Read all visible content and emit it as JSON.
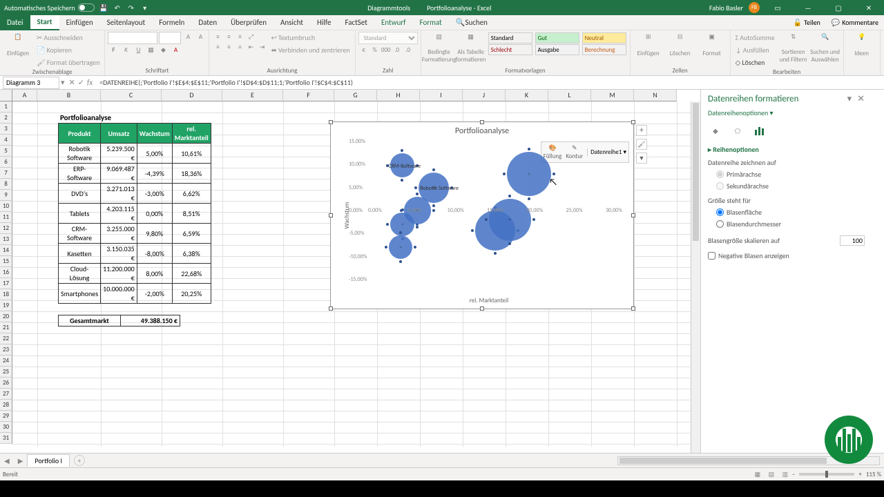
{
  "title_bar": {
    "autosave": "Automatisches Speichern",
    "tooltitle": "Diagrammtools",
    "filetitle": "Portfolioanalyse - Excel",
    "user": "Fabio Basler",
    "user_initials": "FB"
  },
  "ribbon_tabs": {
    "datei": "Datei",
    "start": "Start",
    "einf": "Einfügen",
    "seitenlayout": "Seitenlayout",
    "formeln": "Formeln",
    "daten": "Daten",
    "ueber": "Überprüfen",
    "ansicht": "Ansicht",
    "hilfe": "Hilfe",
    "factset": "FactSet",
    "entwurf": "Entwurf",
    "format": "Format",
    "search": "Suchen",
    "teilen": "Teilen",
    "kommentare": "Kommentare"
  },
  "ribbon_groups": {
    "g1": "Zwischenablage",
    "g2": "Schriftart",
    "g3": "Ausrichtung",
    "g4": "Zahl",
    "g5": "Formatvorlagen",
    "g6": "Zellen",
    "g7": "Bearbeiten",
    "einfuegen": "Einfügen",
    "ausschneiden": "Ausschneiden",
    "kopieren": "Kopieren",
    "formatueb": "Format übertragen",
    "textumbruch": "Textumbruch",
    "verbinden": "Verbinden und zentrieren",
    "bedingte": "Bedingte\nFormatierung",
    "alstabelle": "Als Tabelle\nformatieren",
    "standard": "Standard",
    "gut": "Gut",
    "neutral": "Neutral",
    "schlecht": "Schlecht",
    "ausgabe": "Ausgabe",
    "berechnung": "Berechnung",
    "cell_einf": "Einfügen",
    "cell_del": "Löschen",
    "cell_fmt": "Format",
    "autosumme": "AutoSumme",
    "ausfuellen": "Ausfüllen",
    "loeschen": "Löschen",
    "sortfilt": "Sortieren und\nFiltern",
    "suchausw": "Suchen und\nAuswählen",
    "ideen": "Ideen",
    "numfmt": "Standard"
  },
  "fx": {
    "namebox": "Diagramm 3",
    "formula": "=DATENREIHE(;'Portfolio I'!$E$4:$E$11;'Portfolio I'!$D$4:$D$11;1;'Portfolio I'!$C$4:$C$11)"
  },
  "columns": [
    "A",
    "B",
    "C",
    "D",
    "E",
    "F",
    "G",
    "H",
    "I",
    "J",
    "K",
    "L",
    "M",
    "N"
  ],
  "table": {
    "title": "Portfolioanalyse",
    "headers": [
      "Produkt",
      "Umsatz",
      "Wachstum",
      "rel. Marktanteil"
    ],
    "rows": [
      [
        "Robotik Software",
        "5.239.500 €",
        "5,00%",
        "10,61%"
      ],
      [
        "ERP-Software",
        "9.069.487 €",
        "-4,39%",
        "18,36%"
      ],
      [
        "DVD's",
        "3.271.013 €",
        "-3,00%",
        "6,62%"
      ],
      [
        "Tablets",
        "4.203.115 €",
        "0,00%",
        "8,51%"
      ],
      [
        "CRM-Software",
        "3.255.000 €",
        "9,80%",
        "6,59%"
      ],
      [
        "Kasetten",
        "3.150.035 €",
        "-8,00%",
        "6,38%"
      ],
      [
        "Cloud-Lösung",
        "11.200.000 €",
        "8,00%",
        "22,68%"
      ],
      [
        "Smartphones",
        "10.000.000 €",
        "-2,00%",
        "20,25%"
      ]
    ],
    "total_label": "Gesamtmarkt",
    "total_value": "49.388.150 €"
  },
  "chart_data": {
    "type": "bubble",
    "title": "Portfolioanalyse",
    "xlabel": "rel. Marktanteil",
    "ylabel": "Wachstum",
    "xlim": [
      0,
      35
    ],
    "ylim": [
      -15,
      15
    ],
    "xticks": [
      "0,00%",
      "5,00%",
      "10,00%",
      "15,00%",
      "20,00%",
      "25,00%",
      "30,00%"
    ],
    "yticks": [
      "15,00%",
      "10,00%",
      "5,00%",
      "0,00%",
      "-5,00%",
      "-10,00%",
      "-15,00%"
    ],
    "series_name": "Datenreihe1",
    "labels_vis": {
      "crm": "CRM-Software",
      "rob": "Robotik Software"
    },
    "points": [
      {
        "x": 10.61,
        "y": 5.0,
        "size": 5239500,
        "label": "Robotik Software"
      },
      {
        "x": 18.36,
        "y": -4.39,
        "size": 9069487,
        "label": "ERP-Software"
      },
      {
        "x": 6.62,
        "y": -3.0,
        "size": 3271013,
        "label": "DVD's"
      },
      {
        "x": 8.51,
        "y": 0.0,
        "size": 4203115,
        "label": "Tablets"
      },
      {
        "x": 6.59,
        "y": 9.8,
        "size": 3255000,
        "label": "CRM-Software"
      },
      {
        "x": 6.38,
        "y": -8.0,
        "size": 3150035,
        "label": "Kasetten"
      },
      {
        "x": 22.68,
        "y": 8.0,
        "size": 11200000,
        "label": "Cloud-Lösung"
      },
      {
        "x": 20.25,
        "y": -2.0,
        "size": 10000000,
        "label": "Smartphones"
      }
    ],
    "minitool": {
      "fill": "Füllung",
      "outline": "Kontur"
    }
  },
  "taskpane": {
    "title": "Datenreihen formatieren",
    "options": "Datenreihenoptionen",
    "section": "Reihenoptionen",
    "draw_on": "Datenreihe zeichnen auf",
    "primary": "Primärachse",
    "secondary": "Sekundärachse",
    "size_for": "Größe steht für",
    "area": "Blasenfläche",
    "diameter": "Blasendurchmesser",
    "scale": "Blasengröße skalieren auf",
    "scale_val": "100",
    "negative": "Negative Blasen anzeigen"
  },
  "sheet_tab": "Portfolio I",
  "status": {
    "ready": "Bereit",
    "zoom": "115 %"
  }
}
